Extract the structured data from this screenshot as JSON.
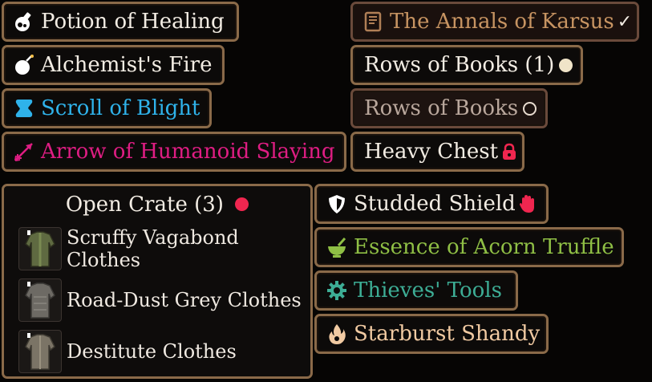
{
  "colors": {
    "uncommon": "#f2ece3",
    "rare": "#2fb2ea",
    "very_rare": "#df1d83",
    "story": "#c79462",
    "green_item": "#8fbf45",
    "teal_item": "#3dad95",
    "gold_item": "#f1caa2",
    "border": "#8a6a49"
  },
  "labels": [
    {
      "text": "Potion of Healing",
      "icon": "potion-flask-icon"
    },
    {
      "text": "Alchemist's Fire",
      "icon": "bomb-icon"
    },
    {
      "text": "Scroll of Blight",
      "icon": "scroll-icon"
    },
    {
      "text": "Arrow of Humanoid Slaying",
      "icon": "arrow-icon"
    },
    {
      "text": "The Annals of Karsus",
      "icon": "book-icon",
      "suffix": "✓"
    },
    {
      "text": "Rows of Books (1)",
      "suffix": "filled-circle"
    },
    {
      "text": "Rows of Books",
      "suffix": "empty-circle"
    },
    {
      "text": "Heavy Chest",
      "suffix": "lock-icon"
    },
    {
      "text": "Studded Shield",
      "icon": "shield-icon",
      "suffix": "hand-icon"
    },
    {
      "text": "Essence of Acorn Truffle",
      "icon": "mortar-icon"
    },
    {
      "text": "Thieves' Tools",
      "icon": "gear-icon"
    },
    {
      "text": "Starburst Shandy",
      "icon": "flame-icon"
    }
  ],
  "crate": {
    "title": "Open Crate (3)",
    "items": [
      {
        "name": "Scruffy Vagabond Clothes",
        "icon": "clothes-icon"
      },
      {
        "name": "Road-Dust Grey Clothes",
        "icon": "clothes-icon"
      },
      {
        "name": "Destitute Clothes",
        "icon": "clothes-icon"
      }
    ]
  }
}
